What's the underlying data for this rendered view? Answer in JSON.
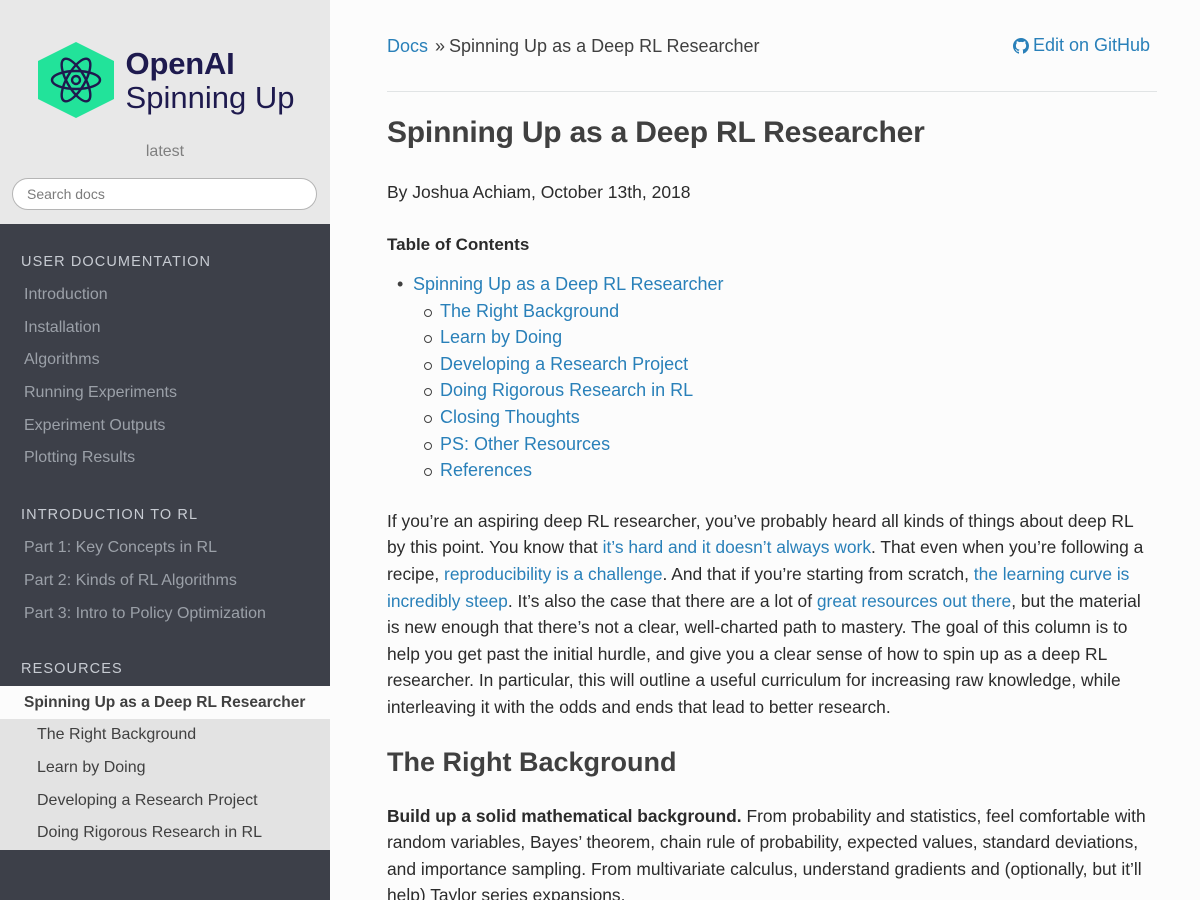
{
  "sidebar": {
    "logo_line1": "OpenAI",
    "logo_line2": "Spinning Up",
    "version": "latest",
    "search_placeholder": "Search docs",
    "sections": [
      {
        "caption": "USER DOCUMENTATION",
        "items": [
          "Introduction",
          "Installation",
          "Algorithms",
          "Running Experiments",
          "Experiment Outputs",
          "Plotting Results"
        ]
      },
      {
        "caption": "INTRODUCTION TO RL",
        "items": [
          "Part 1: Key Concepts in RL",
          "Part 2: Kinds of RL Algorithms",
          "Part 3: Intro to Policy Optimization"
        ]
      },
      {
        "caption": "RESOURCES",
        "current": "Spinning Up as a Deep RL Researcher",
        "subitems": [
          "The Right Background",
          "Learn by Doing",
          "Developing a Research Project",
          "Doing Rigorous Research in RL"
        ]
      }
    ]
  },
  "breadcrumbs": {
    "docs": "Docs",
    "separator": "»",
    "current": "Spinning Up as a Deep RL Researcher",
    "edit": "Edit on GitHub"
  },
  "article": {
    "title": "Spinning Up as a Deep RL Researcher",
    "byline": "By Joshua Achiam, October 13th, 2018",
    "toc_title": "Table of Contents",
    "toc_top": "Spinning Up as a Deep RL Researcher",
    "toc_items": [
      "The Right Background",
      "Learn by Doing",
      "Developing a Research Project",
      "Doing Rigorous Research in RL",
      "Closing Thoughts",
      "PS: Other Resources",
      "References"
    ],
    "intro": {
      "t1": "If you’re an aspiring deep RL researcher, you’ve probably heard all kinds of things about deep RL by this point. You know that ",
      "l1": "it’s hard and it doesn’t always work",
      "t2": ". That even when you’re following a recipe, ",
      "l2": "reproducibility is a challenge",
      "t3": ". And that if you’re starting from scratch, ",
      "l3": "the learning curve is incredibly steep",
      "t4": ". It’s also the case that there are a lot of ",
      "l4": "great resources out there",
      "t5": ", but the material is new enough that there’s not a clear, well-charted path to mastery. The goal of this column is to help you get past the initial hurdle, and give you a clear sense of how to spin up as a deep RL researcher. In particular, this will outline a useful curriculum for increasing raw knowledge, while interleaving it with the odds and ends that lead to better research."
    },
    "section_title": "The Right Background",
    "bg_bold": "Build up a solid mathematical background.",
    "bg_text": " From probability and statistics, feel comfortable with random variables, Bayes’ theorem, chain rule of probability, expected values, standard deviations, and importance sampling. From multivariate calculus, understand gradients and (optionally, but it’ll help) Taylor series expansions."
  },
  "colors": {
    "link": "#2980b9",
    "sidebar_bg": "#3d4049",
    "logo_green": "#22e39a"
  }
}
